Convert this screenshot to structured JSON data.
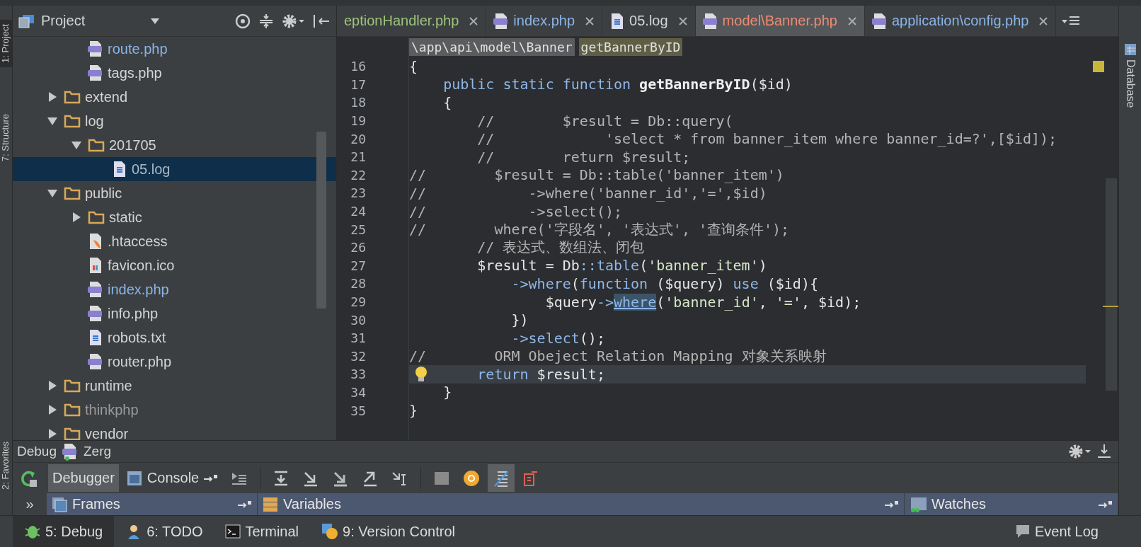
{
  "side_tools": [
    {
      "label": "1: Project",
      "selected": true
    },
    {
      "label": "7: Structure",
      "selected": false
    },
    {
      "label": "2: Favorites",
      "selected": false
    }
  ],
  "project": {
    "title": "Project",
    "tree": [
      {
        "children": [
          {
            "label": "route.php",
            "kind": "php",
            "color": "#8ab4e8",
            "selected": false
          },
          {
            "label": "tags.php",
            "kind": "php",
            "color": "#d4d4d4",
            "selected": false
          }
        ]
      },
      {
        "label": "extend",
        "kind": "folder",
        "expanded": false,
        "color": "#d4d4d4",
        "selected": false
      },
      {
        "label": "log",
        "kind": "folder",
        "expanded": true,
        "color": "#d4d4d4",
        "selected": false,
        "children": [
          {
            "label": "201705",
            "kind": "folder",
            "expanded": true,
            "color": "#d4d4d4",
            "selected": false,
            "children": [
              {
                "label": "05.log",
                "kind": "text",
                "color": "#a8b8c8",
                "selected": true
              }
            ]
          }
        ]
      },
      {
        "label": "public",
        "kind": "folder",
        "expanded": true,
        "color": "#d4d4d4",
        "selected": false,
        "children": [
          {
            "label": "static",
            "kind": "folder",
            "expanded": false,
            "color": "#d4d4d4",
            "selected": false
          },
          {
            "label": ".htaccess",
            "kind": "htaccess",
            "color": "#d4d4d4",
            "selected": false
          },
          {
            "label": "favicon.ico",
            "kind": "image",
            "color": "#d4d4d4",
            "selected": false
          },
          {
            "label": "index.php",
            "kind": "php",
            "color": "#8ab4e8",
            "selected": false
          },
          {
            "label": "info.php",
            "kind": "php",
            "color": "#d4d4d4",
            "selected": false
          },
          {
            "label": "robots.txt",
            "kind": "text",
            "color": "#d4d4d4",
            "selected": false
          },
          {
            "label": "router.php",
            "kind": "php",
            "color": "#d4d4d4",
            "selected": false
          }
        ]
      },
      {
        "label": "runtime",
        "kind": "folder",
        "expanded": false,
        "color": "#d4d4d4",
        "selected": false
      },
      {
        "label": "thinkphp",
        "kind": "folder",
        "expanded": false,
        "color": "#9a9a9a",
        "selected": false
      },
      {
        "label": "vendor",
        "kind": "folder",
        "expanded": false,
        "color": "#d4d4d4",
        "selected": false
      }
    ]
  },
  "tabs": [
    {
      "label": "eptionHandler.php",
      "kind": "none",
      "color": "#9cc47a",
      "selected": false
    },
    {
      "label": "index.php",
      "kind": "php",
      "color": "#8ab4e8",
      "selected": false
    },
    {
      "label": "05.log",
      "kind": "text",
      "color": "#d4d4d4",
      "selected": false
    },
    {
      "label": "model\\Banner.php",
      "kind": "php",
      "color": "#f08a70",
      "selected": true
    },
    {
      "label": "application\\config.php",
      "kind": "php",
      "color": "#8ab4e8",
      "selected": false
    }
  ],
  "breadcrumb": [
    "\\app\\api\\model\\Banner",
    "getBannerByID"
  ],
  "code": [
    {
      "number": "16",
      "current": false,
      "bulb": false,
      "segments": [
        {
          "kind": "plain",
          "text": "{"
        }
      ]
    },
    {
      "number": "17",
      "current": false,
      "bulb": false,
      "segments": [
        {
          "kind": "keyword",
          "text": "    public static function "
        },
        {
          "kind": "decl",
          "text": "getBannerByID"
        },
        {
          "kind": "plain",
          "text": "($id)"
        }
      ]
    },
    {
      "number": "18",
      "current": false,
      "bulb": false,
      "segments": [
        {
          "kind": "plain",
          "text": "    {"
        }
      ]
    },
    {
      "number": "19",
      "current": false,
      "bulb": false,
      "segments": [
        {
          "kind": "comment",
          "text": "        //        $result = Db::query("
        }
      ]
    },
    {
      "number": "20",
      "current": false,
      "bulb": false,
      "segments": [
        {
          "kind": "comment",
          "text": "        //             'select * from banner_item where banner_id=?',[$id]);"
        }
      ]
    },
    {
      "number": "21",
      "current": false,
      "bulb": false,
      "segments": [
        {
          "kind": "comment",
          "text": "        //        return $result;"
        }
      ]
    },
    {
      "number": "22",
      "current": false,
      "bulb": false,
      "segments": [
        {
          "kind": "comment",
          "text": "//        $result = Db::table('banner_item')"
        }
      ]
    },
    {
      "number": "23",
      "current": false,
      "bulb": false,
      "segments": [
        {
          "kind": "comment",
          "text": "//            ->where('banner_id','=',$id)"
        }
      ]
    },
    {
      "number": "24",
      "current": false,
      "bulb": false,
      "segments": [
        {
          "kind": "comment",
          "text": "//            ->select();"
        }
      ]
    },
    {
      "number": "25",
      "current": false,
      "bulb": false,
      "segments": [
        {
          "kind": "comment",
          "text": "//        where('字段名', '表达式', '查询条件');"
        }
      ]
    },
    {
      "number": "26",
      "current": false,
      "bulb": false,
      "segments": [
        {
          "kind": "comment",
          "text": "        // 表达式、数组法、闭包"
        }
      ]
    },
    {
      "number": "27",
      "current": false,
      "bulb": false,
      "segments": [
        {
          "kind": "plain",
          "text": "        $result = Db"
        },
        {
          "kind": "call",
          "text": "::table"
        },
        {
          "kind": "plain",
          "text": "("
        },
        {
          "kind": "string",
          "text": "'banner_item'"
        },
        {
          "kind": "plain",
          "text": ")"
        }
      ]
    },
    {
      "number": "28",
      "current": false,
      "bulb": false,
      "segments": [
        {
          "kind": "call",
          "text": "            ->where"
        },
        {
          "kind": "plain",
          "text": "("
        },
        {
          "kind": "keyword",
          "text": "function"
        },
        {
          "kind": "plain",
          "text": " ($query) "
        },
        {
          "kind": "keyword",
          "text": "use"
        },
        {
          "kind": "plain",
          "text": " ($id){"
        }
      ]
    },
    {
      "number": "29",
      "current": false,
      "bulb": false,
      "segments": [
        {
          "kind": "plain",
          "text": "                $query"
        },
        {
          "kind": "call",
          "text": "->"
        },
        {
          "kind": "match",
          "text": "where"
        },
        {
          "kind": "plain",
          "text": "("
        },
        {
          "kind": "string",
          "text": "'banner_id'"
        },
        {
          "kind": "plain",
          "text": ", "
        },
        {
          "kind": "string",
          "text": "'='"
        },
        {
          "kind": "plain",
          "text": ", $id);"
        }
      ]
    },
    {
      "number": "30",
      "current": false,
      "bulb": false,
      "segments": [
        {
          "kind": "plain",
          "text": "            })"
        }
      ]
    },
    {
      "number": "31",
      "current": false,
      "bulb": false,
      "segments": [
        {
          "kind": "call",
          "text": "            ->select"
        },
        {
          "kind": "plain",
          "text": "();"
        }
      ]
    },
    {
      "number": "32",
      "current": false,
      "bulb": false,
      "segments": [
        {
          "kind": "comment",
          "text": "//        ORM Obeject Relation Mapping 对象关系映射"
        }
      ]
    },
    {
      "number": "33",
      "current": true,
      "bulb": true,
      "segments": [
        {
          "kind": "keyword",
          "text": "        return"
        },
        {
          "kind": "plain",
          "text": " $result;"
        }
      ]
    },
    {
      "number": "34",
      "current": false,
      "bulb": false,
      "segments": [
        {
          "kind": "plain",
          "text": "    }"
        }
      ]
    },
    {
      "number": "35",
      "current": false,
      "bulb": false,
      "segments": [
        {
          "kind": "plain",
          "text": "}"
        }
      ]
    }
  ],
  "right_tools": [
    {
      "label": "Database"
    }
  ],
  "debug": {
    "title": "Debug",
    "config": "Zerg",
    "tabs": [
      {
        "label": "Debugger",
        "selected": true
      },
      {
        "label": "Console",
        "selected": false
      }
    ],
    "tools": [
      {
        "kind": "execpoint",
        "selected": false
      },
      {
        "kind": "stepover",
        "selected": false
      },
      {
        "kind": "stepinto",
        "selected": false
      },
      {
        "kind": "forcestep",
        "selected": false
      },
      {
        "kind": "stepout",
        "selected": false
      },
      {
        "kind": "runcursor",
        "selected": false
      },
      {
        "kind": "evaluate",
        "selected": false
      },
      {
        "kind": "watch",
        "selected": false
      },
      {
        "kind": "toggle",
        "selected": true
      },
      {
        "kind": "restore",
        "selected": false
      }
    ],
    "more": "»",
    "panes": [
      {
        "label": "Frames",
        "kind": "frames"
      },
      {
        "label": "Variables",
        "kind": "variables"
      },
      {
        "label": "Watches",
        "kind": "watches"
      }
    ]
  },
  "status_bar": [
    {
      "label": "5: Debug",
      "kind": "debug",
      "selected": true
    },
    {
      "label": "6: TODO",
      "kind": "todo",
      "selected": false
    },
    {
      "label": "Terminal",
      "kind": "terminal",
      "selected": false
    },
    {
      "label": "9: Version Control",
      "kind": "vcs",
      "selected": false
    }
  ],
  "event_log": "Event Log"
}
